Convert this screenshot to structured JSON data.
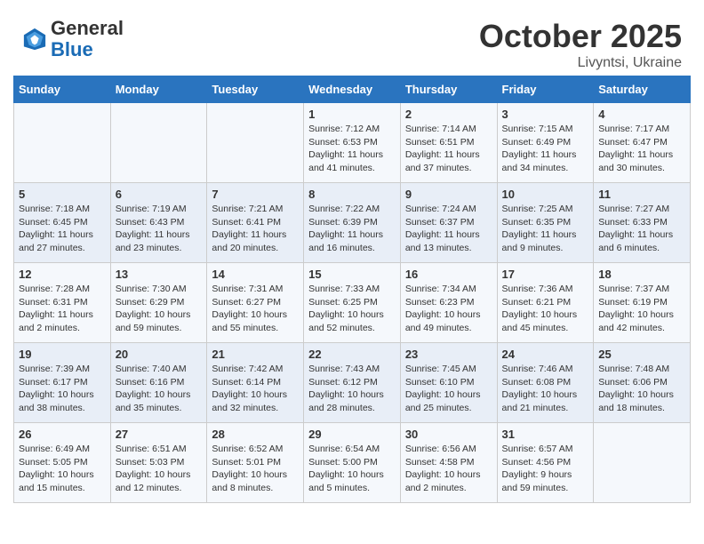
{
  "header": {
    "logo_line1": "General",
    "logo_line2": "Blue",
    "month": "October 2025",
    "location": "Livyntsi, Ukraine"
  },
  "weekdays": [
    "Sunday",
    "Monday",
    "Tuesday",
    "Wednesday",
    "Thursday",
    "Friday",
    "Saturday"
  ],
  "weeks": [
    [
      {
        "day": "",
        "info": ""
      },
      {
        "day": "",
        "info": ""
      },
      {
        "day": "",
        "info": ""
      },
      {
        "day": "1",
        "info": "Sunrise: 7:12 AM\nSunset: 6:53 PM\nDaylight: 11 hours\nand 41 minutes."
      },
      {
        "day": "2",
        "info": "Sunrise: 7:14 AM\nSunset: 6:51 PM\nDaylight: 11 hours\nand 37 minutes."
      },
      {
        "day": "3",
        "info": "Sunrise: 7:15 AM\nSunset: 6:49 PM\nDaylight: 11 hours\nand 34 minutes."
      },
      {
        "day": "4",
        "info": "Sunrise: 7:17 AM\nSunset: 6:47 PM\nDaylight: 11 hours\nand 30 minutes."
      }
    ],
    [
      {
        "day": "5",
        "info": "Sunrise: 7:18 AM\nSunset: 6:45 PM\nDaylight: 11 hours\nand 27 minutes."
      },
      {
        "day": "6",
        "info": "Sunrise: 7:19 AM\nSunset: 6:43 PM\nDaylight: 11 hours\nand 23 minutes."
      },
      {
        "day": "7",
        "info": "Sunrise: 7:21 AM\nSunset: 6:41 PM\nDaylight: 11 hours\nand 20 minutes."
      },
      {
        "day": "8",
        "info": "Sunrise: 7:22 AM\nSunset: 6:39 PM\nDaylight: 11 hours\nand 16 minutes."
      },
      {
        "day": "9",
        "info": "Sunrise: 7:24 AM\nSunset: 6:37 PM\nDaylight: 11 hours\nand 13 minutes."
      },
      {
        "day": "10",
        "info": "Sunrise: 7:25 AM\nSunset: 6:35 PM\nDaylight: 11 hours\nand 9 minutes."
      },
      {
        "day": "11",
        "info": "Sunrise: 7:27 AM\nSunset: 6:33 PM\nDaylight: 11 hours\nand 6 minutes."
      }
    ],
    [
      {
        "day": "12",
        "info": "Sunrise: 7:28 AM\nSunset: 6:31 PM\nDaylight: 11 hours\nand 2 minutes."
      },
      {
        "day": "13",
        "info": "Sunrise: 7:30 AM\nSunset: 6:29 PM\nDaylight: 10 hours\nand 59 minutes."
      },
      {
        "day": "14",
        "info": "Sunrise: 7:31 AM\nSunset: 6:27 PM\nDaylight: 10 hours\nand 55 minutes."
      },
      {
        "day": "15",
        "info": "Sunrise: 7:33 AM\nSunset: 6:25 PM\nDaylight: 10 hours\nand 52 minutes."
      },
      {
        "day": "16",
        "info": "Sunrise: 7:34 AM\nSunset: 6:23 PM\nDaylight: 10 hours\nand 49 minutes."
      },
      {
        "day": "17",
        "info": "Sunrise: 7:36 AM\nSunset: 6:21 PM\nDaylight: 10 hours\nand 45 minutes."
      },
      {
        "day": "18",
        "info": "Sunrise: 7:37 AM\nSunset: 6:19 PM\nDaylight: 10 hours\nand 42 minutes."
      }
    ],
    [
      {
        "day": "19",
        "info": "Sunrise: 7:39 AM\nSunset: 6:17 PM\nDaylight: 10 hours\nand 38 minutes."
      },
      {
        "day": "20",
        "info": "Sunrise: 7:40 AM\nSunset: 6:16 PM\nDaylight: 10 hours\nand 35 minutes."
      },
      {
        "day": "21",
        "info": "Sunrise: 7:42 AM\nSunset: 6:14 PM\nDaylight: 10 hours\nand 32 minutes."
      },
      {
        "day": "22",
        "info": "Sunrise: 7:43 AM\nSunset: 6:12 PM\nDaylight: 10 hours\nand 28 minutes."
      },
      {
        "day": "23",
        "info": "Sunrise: 7:45 AM\nSunset: 6:10 PM\nDaylight: 10 hours\nand 25 minutes."
      },
      {
        "day": "24",
        "info": "Sunrise: 7:46 AM\nSunset: 6:08 PM\nDaylight: 10 hours\nand 21 minutes."
      },
      {
        "day": "25",
        "info": "Sunrise: 7:48 AM\nSunset: 6:06 PM\nDaylight: 10 hours\nand 18 minutes."
      }
    ],
    [
      {
        "day": "26",
        "info": "Sunrise: 6:49 AM\nSunset: 5:05 PM\nDaylight: 10 hours\nand 15 minutes."
      },
      {
        "day": "27",
        "info": "Sunrise: 6:51 AM\nSunset: 5:03 PM\nDaylight: 10 hours\nand 12 minutes."
      },
      {
        "day": "28",
        "info": "Sunrise: 6:52 AM\nSunset: 5:01 PM\nDaylight: 10 hours\nand 8 minutes."
      },
      {
        "day": "29",
        "info": "Sunrise: 6:54 AM\nSunset: 5:00 PM\nDaylight: 10 hours\nand 5 minutes."
      },
      {
        "day": "30",
        "info": "Sunrise: 6:56 AM\nSunset: 4:58 PM\nDaylight: 10 hours\nand 2 minutes."
      },
      {
        "day": "31",
        "info": "Sunrise: 6:57 AM\nSunset: 4:56 PM\nDaylight: 9 hours\nand 59 minutes."
      },
      {
        "day": "",
        "info": ""
      }
    ]
  ]
}
